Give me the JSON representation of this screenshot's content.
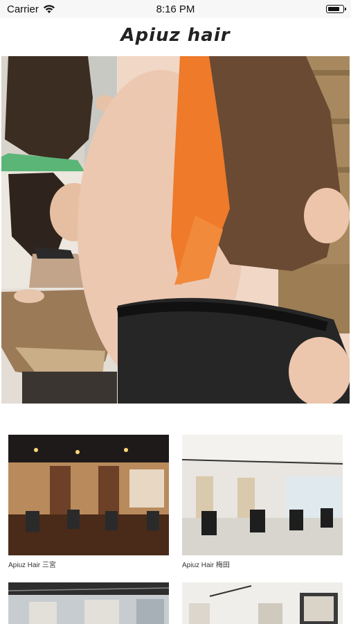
{
  "status_bar": {
    "carrier": "Carrier",
    "time": "8:16 PM"
  },
  "header": {
    "brand": "Apiuz hair"
  },
  "carousel": {
    "pages": 4,
    "active_index": 0
  },
  "salons": [
    {
      "name": "Apiuz Hair 三宮"
    },
    {
      "name": "Apiuz Hair 梅田"
    },
    {
      "name": ""
    },
    {
      "name": ""
    }
  ]
}
